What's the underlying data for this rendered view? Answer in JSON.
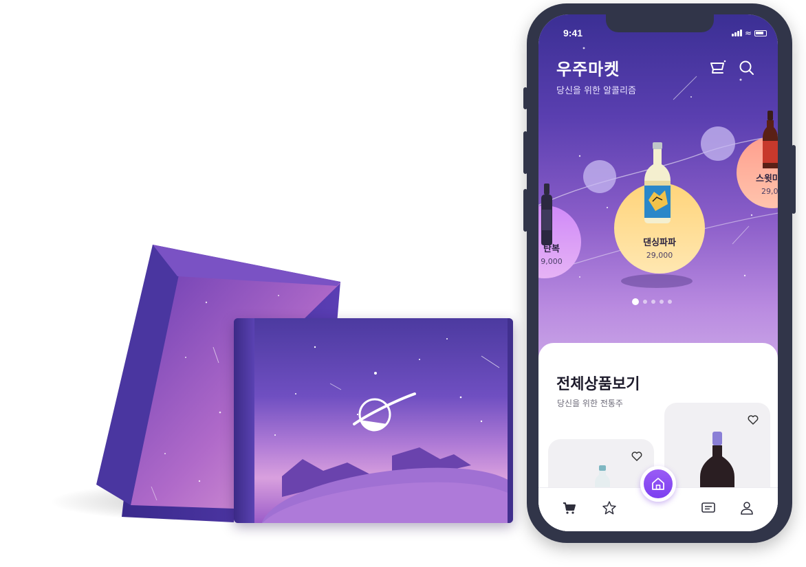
{
  "status_bar": {
    "time": "9:41"
  },
  "app": {
    "title": "우주마켓",
    "subtitle": "당신을 위한 알콜리즘"
  },
  "header_icons": [
    "cart-icon",
    "search-icon"
  ],
  "carousel": {
    "items": [
      {
        "name": "탄복",
        "price": "9,000",
        "bubble_color": "#d8a7ff"
      },
      {
        "name": "댄싱파파",
        "price": "29,000",
        "bubble_color": "#ffe09a"
      },
      {
        "name": "스윗마",
        "price": "29,0",
        "bubble_color": "#ffb7a1"
      }
    ],
    "pagination": {
      "count": 5,
      "active": 1
    }
  },
  "catalog": {
    "title": "전체상품보기",
    "subtitle": "당신을 위한 전통주"
  },
  "tabbar": {
    "items": [
      "cart-icon",
      "star-icon",
      "home-icon",
      "chat-icon",
      "user-icon"
    ],
    "active": "home-icon",
    "accent_color": "#8a4cf3"
  },
  "colors": {
    "hero_top": "#3b2f94",
    "hero_bottom": "#c8a3e6",
    "phone_frame": "#313549"
  }
}
